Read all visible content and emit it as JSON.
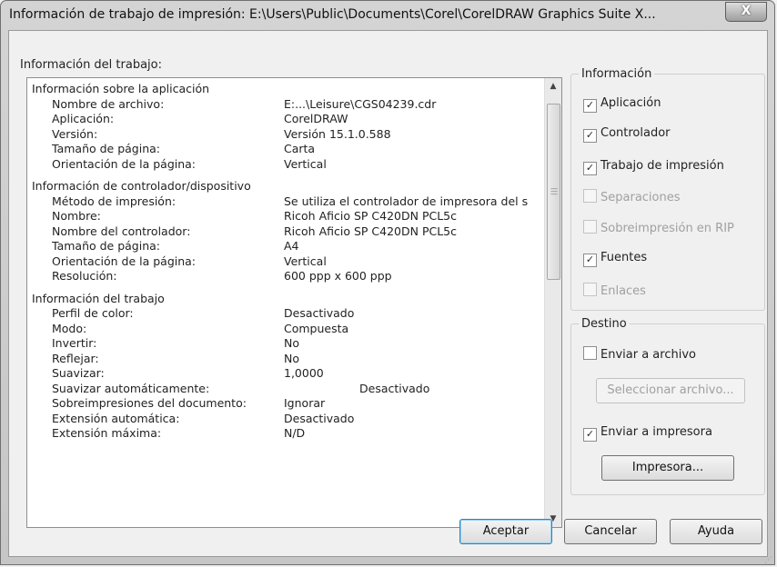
{
  "window": {
    "title": "Información de trabajo de impresión: E:\\Users\\Public\\Documents\\Corel\\CorelDRAW Graphics Suite X...",
    "close_glyph": "X"
  },
  "job_info_label": "Información del trabajo:",
  "app_section": {
    "header": "Información sobre la aplicación",
    "rows": [
      {
        "key": "Nombre de archivo:",
        "value": "E:...\\Leisure\\CGS04239.cdr"
      },
      {
        "key": "Aplicación:",
        "value": "CorelDRAW"
      },
      {
        "key": "Versión:",
        "value": "Versión 15.1.0.588"
      },
      {
        "key": "Tamaño de página:",
        "value": "Carta"
      },
      {
        "key": "Orientación de la página:",
        "value": "Vertical"
      }
    ]
  },
  "driver_section": {
    "header": "Información de controlador/dispositivo",
    "rows": [
      {
        "key": "Método de impresión:",
        "value": "Se utiliza el controlador de impresora del s"
      },
      {
        "key": "Nombre:",
        "value": "Ricoh Aficio SP C420DN PCL5c"
      },
      {
        "key": "Nombre del controlador:",
        "value": "Ricoh Aficio SP C420DN PCL5c"
      },
      {
        "key": "Tamaño de página:",
        "value": "A4"
      },
      {
        "key": "Orientación de la página:",
        "value": "Vertical"
      },
      {
        "key": "Resolución:",
        "value": "600 ppp x 600 ppp"
      }
    ]
  },
  "job_section": {
    "header": "Información del trabajo",
    "rows": [
      {
        "key": "Perfil de color:",
        "value": "Desactivado"
      },
      {
        "key": "Modo:",
        "value": "Compuesta"
      },
      {
        "key": "Invertir:",
        "value": "No"
      },
      {
        "key": "Reflejar:",
        "value": "No"
      },
      {
        "key": "Suavizar:",
        "value": "1,0000"
      },
      {
        "key": "Suavizar automáticamente:",
        "value": "Desactivado"
      },
      {
        "key": "Sobreimpresiones del documento:",
        "value": "Ignorar"
      },
      {
        "key": "Extensión automática:",
        "value": "Desactivado"
      },
      {
        "key": "Extensión máxima:",
        "value": "N/D"
      }
    ]
  },
  "info_group": {
    "legend": "Información",
    "items": [
      {
        "label": "Aplicación",
        "checked": true,
        "enabled": true
      },
      {
        "label": "Controlador",
        "checked": true,
        "enabled": true
      },
      {
        "label": "Trabajo de impresión",
        "checked": true,
        "enabled": true
      },
      {
        "label": "Separaciones",
        "checked": false,
        "enabled": false
      },
      {
        "label": "Sobreimpresión en RIP",
        "checked": false,
        "enabled": false
      },
      {
        "label": "Fuentes",
        "checked": true,
        "enabled": true
      },
      {
        "label": "Enlaces",
        "checked": false,
        "enabled": false
      }
    ]
  },
  "dest_group": {
    "legend": "Destino",
    "send_to_file": {
      "label": "Enviar a archivo",
      "checked": false
    },
    "select_file_button": "Seleccionar archivo...",
    "send_to_printer": {
      "label": "Enviar a impresora",
      "checked": true
    },
    "printer_button": "Impresora..."
  },
  "buttons": {
    "ok": "Aceptar",
    "cancel": "Cancelar",
    "help": "Ayuda"
  },
  "check_glyph": "✓",
  "scroll": {
    "up_glyph": "▲",
    "down_glyph": "▼"
  }
}
